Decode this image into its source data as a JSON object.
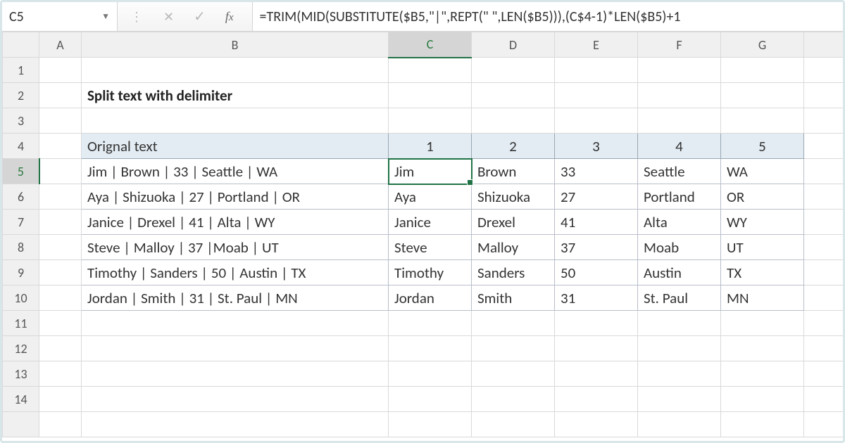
{
  "name_box": "C5",
  "formula_bar": "=TRIM(MID(SUBSTITUTE($B5,\"|\",REPT(\" \",LEN($B5))),(C$4-1)*LEN($B5)+1",
  "columns": [
    "A",
    "B",
    "C",
    "D",
    "E",
    "F",
    "G"
  ],
  "row_numbers": [
    "1",
    "2",
    "3",
    "4",
    "5",
    "6",
    "7",
    "8",
    "9",
    "10",
    "11",
    "12",
    "13",
    "14"
  ],
  "active_cell": "C5",
  "title": "Split text with delimiter",
  "headers": {
    "original": "Orignal text",
    "n1": "1",
    "n2": "2",
    "n3": "3",
    "n4": "4",
    "n5": "5"
  },
  "rows": [
    {
      "orig": "Jim | Brown | 33 | Seattle | WA",
      "c1": "Jim",
      "c2": "Brown",
      "c3": "33",
      "c4": "Seattle",
      "c5": "WA"
    },
    {
      "orig": "Aya | Shizuoka | 27 | Portland | OR",
      "c1": "Aya",
      "c2": "Shizuoka",
      "c3": "27",
      "c4": "Portland",
      "c5": "OR"
    },
    {
      "orig": "Janice | Drexel | 41 | Alta | WY",
      "c1": "Janice",
      "c2": "Drexel",
      "c3": "41",
      "c4": "Alta",
      "c5": "WY"
    },
    {
      "orig": "Steve | Malloy | 37 |Moab | UT",
      "c1": "Steve",
      "c2": "Malloy",
      "c3": "37",
      "c4": "Moab",
      "c5": "UT"
    },
    {
      "orig": "Timothy | Sanders | 50 | Austin | TX",
      "c1": "Timothy",
      "c2": "Sanders",
      "c3": "50",
      "c4": "Austin",
      "c5": "TX"
    },
    {
      "orig": "Jordan | Smith | 31 | St. Paul | MN",
      "c1": "Jordan",
      "c2": "Smith",
      "c3": "31",
      "c4": "St. Paul",
      "c5": "MN"
    }
  ]
}
